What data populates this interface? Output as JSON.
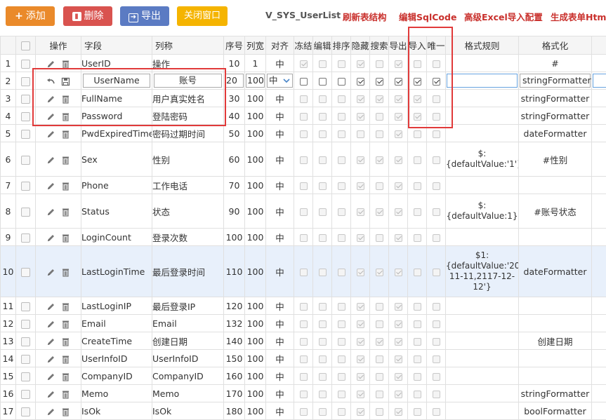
{
  "toolbar": {
    "add_label": "添加",
    "delete_label": "删除",
    "export_label": "导出",
    "close_label": "关闭窗口",
    "table_name": "V_SYS_UserList",
    "refresh_label": "刷新表结构",
    "edit_sql_label": "编辑SqlCode",
    "excel_import_label": "高级Excel导入配置",
    "generate_form_label": "生成表单Html"
  },
  "colors": {
    "add": "#ea8a2a",
    "delete": "#d9534f",
    "export": "#5b7bc3",
    "close": "#f5b400",
    "highlight": "#e13a3a"
  },
  "icons": {
    "add": "plus-icon",
    "delete": "trash-icon",
    "export": "export-icon",
    "edit": "pencil-icon",
    "remove": "trash-icon",
    "undo": "undo-icon",
    "save": "save-icon"
  },
  "headers": {
    "ops": "操作",
    "field": "字段",
    "column_name": "列称",
    "order": "序号",
    "width": "列宽",
    "align": "对齐",
    "freeze": "冻结",
    "edit": "编辑",
    "sort": "排序",
    "hidden": "隐藏",
    "search": "搜索",
    "export": "导出",
    "import": "导入",
    "unique": "唯一",
    "format_rule": "格式规则",
    "formatter": "格式化"
  },
  "editing_row": {
    "field": "UserName",
    "column_name": "账号",
    "order": "20",
    "width": "100",
    "align": "中",
    "formatter": "stringFormatter"
  },
  "rows": [
    {
      "n": "1",
      "field": "UserID",
      "name": "操作",
      "order": "10",
      "width": "1",
      "align": "中",
      "rule": "",
      "fmt": "#",
      "flags": [
        1,
        0,
        0,
        1,
        0,
        1,
        0,
        0
      ]
    },
    {
      "n": "2",
      "editing": true,
      "flags": [
        0,
        0,
        0,
        1,
        1,
        1,
        1,
        1
      ]
    },
    {
      "n": "3",
      "field": "FullName",
      "name": "用户真实姓名",
      "order": "30",
      "width": "100",
      "align": "中",
      "rule": "",
      "fmt": "stringFormatter",
      "flags": [
        0,
        0,
        0,
        1,
        1,
        1,
        1,
        0
      ]
    },
    {
      "n": "4",
      "field": "Password",
      "name": "登陆密码",
      "order": "40",
      "width": "100",
      "align": "中",
      "rule": "",
      "fmt": "stringFormatter",
      "flags": [
        0,
        0,
        0,
        1,
        0,
        1,
        1,
        0
      ]
    },
    {
      "n": "5",
      "field": "PwdExpiredTime",
      "name": "密码过期时间",
      "order": "50",
      "width": "100",
      "align": "中",
      "rule": "",
      "fmt": "dateFormatter",
      "flags": [
        0,
        0,
        0,
        0,
        0,
        1,
        0,
        0
      ]
    },
    {
      "n": "6",
      "field": "Sex",
      "name": "性别",
      "order": "60",
      "width": "100",
      "align": "中",
      "rule": "$:\n{defaultValue:'1'}",
      "fmt": "#性别",
      "flags": [
        0,
        0,
        0,
        1,
        1,
        1,
        0,
        0
      ]
    },
    {
      "n": "7",
      "field": "Phone",
      "name": "工作电话",
      "order": "70",
      "width": "100",
      "align": "中",
      "rule": "",
      "fmt": "",
      "flags": [
        0,
        0,
        0,
        1,
        0,
        1,
        0,
        0
      ]
    },
    {
      "n": "8",
      "field": "Status",
      "name": "状态",
      "order": "90",
      "width": "100",
      "align": "中",
      "rule": "$:\n{defaultValue:1}",
      "fmt": "#账号状态",
      "flags": [
        0,
        0,
        0,
        1,
        1,
        1,
        0,
        0
      ]
    },
    {
      "n": "9",
      "field": "LoginCount",
      "name": "登录次数",
      "order": "100",
      "width": "100",
      "align": "中",
      "rule": "",
      "fmt": "",
      "flags": [
        0,
        0,
        0,
        1,
        0,
        1,
        0,
        0
      ]
    },
    {
      "n": "10",
      "field": "LastLoginTime",
      "name": "最后登录时间",
      "order": "110",
      "width": "100",
      "align": "中",
      "rule": "$1:\n{defaultValue:'20(\n11-11,2117-12-\n12'}",
      "fmt": "dateFormatter",
      "flags": [
        0,
        0,
        0,
        1,
        1,
        1,
        0,
        0
      ],
      "sel": true
    },
    {
      "n": "11",
      "field": "LastLoginIP",
      "name": "最后登录IP",
      "order": "120",
      "width": "100",
      "align": "中",
      "rule": "",
      "fmt": "",
      "flags": [
        0,
        0,
        0,
        1,
        0,
        1,
        0,
        0
      ]
    },
    {
      "n": "12",
      "field": "Email",
      "name": "Email",
      "order": "132",
      "width": "100",
      "align": "中",
      "rule": "",
      "fmt": "",
      "flags": [
        0,
        0,
        0,
        1,
        0,
        1,
        0,
        0
      ]
    },
    {
      "n": "13",
      "field": "CreateTime",
      "name": "创建日期",
      "order": "140",
      "width": "100",
      "align": "中",
      "rule": "",
      "fmt": "创建日期",
      "flags": [
        0,
        0,
        0,
        1,
        1,
        1,
        0,
        0
      ]
    },
    {
      "n": "14",
      "field": "UserInfoID",
      "name": "UserInfoID",
      "order": "150",
      "width": "100",
      "align": "中",
      "rule": "",
      "fmt": "",
      "flags": [
        0,
        0,
        0,
        1,
        0,
        1,
        0,
        0
      ]
    },
    {
      "n": "15",
      "field": "CompanyID",
      "name": "CompanyID",
      "order": "160",
      "width": "100",
      "align": "中",
      "rule": "",
      "fmt": "",
      "flags": [
        0,
        0,
        0,
        1,
        0,
        1,
        0,
        0
      ]
    },
    {
      "n": "16",
      "field": "Memo",
      "name": "Memo",
      "order": "170",
      "width": "100",
      "align": "中",
      "rule": "",
      "fmt": "stringFormatter",
      "flags": [
        0,
        0,
        0,
        1,
        0,
        1,
        0,
        0
      ]
    },
    {
      "n": "17",
      "field": "IsOk",
      "name": "IsOk",
      "order": "180",
      "width": "100",
      "align": "中",
      "rule": "",
      "fmt": "boolFormatter",
      "flags": [
        0,
        0,
        0,
        1,
        0,
        1,
        0,
        0
      ]
    }
  ]
}
